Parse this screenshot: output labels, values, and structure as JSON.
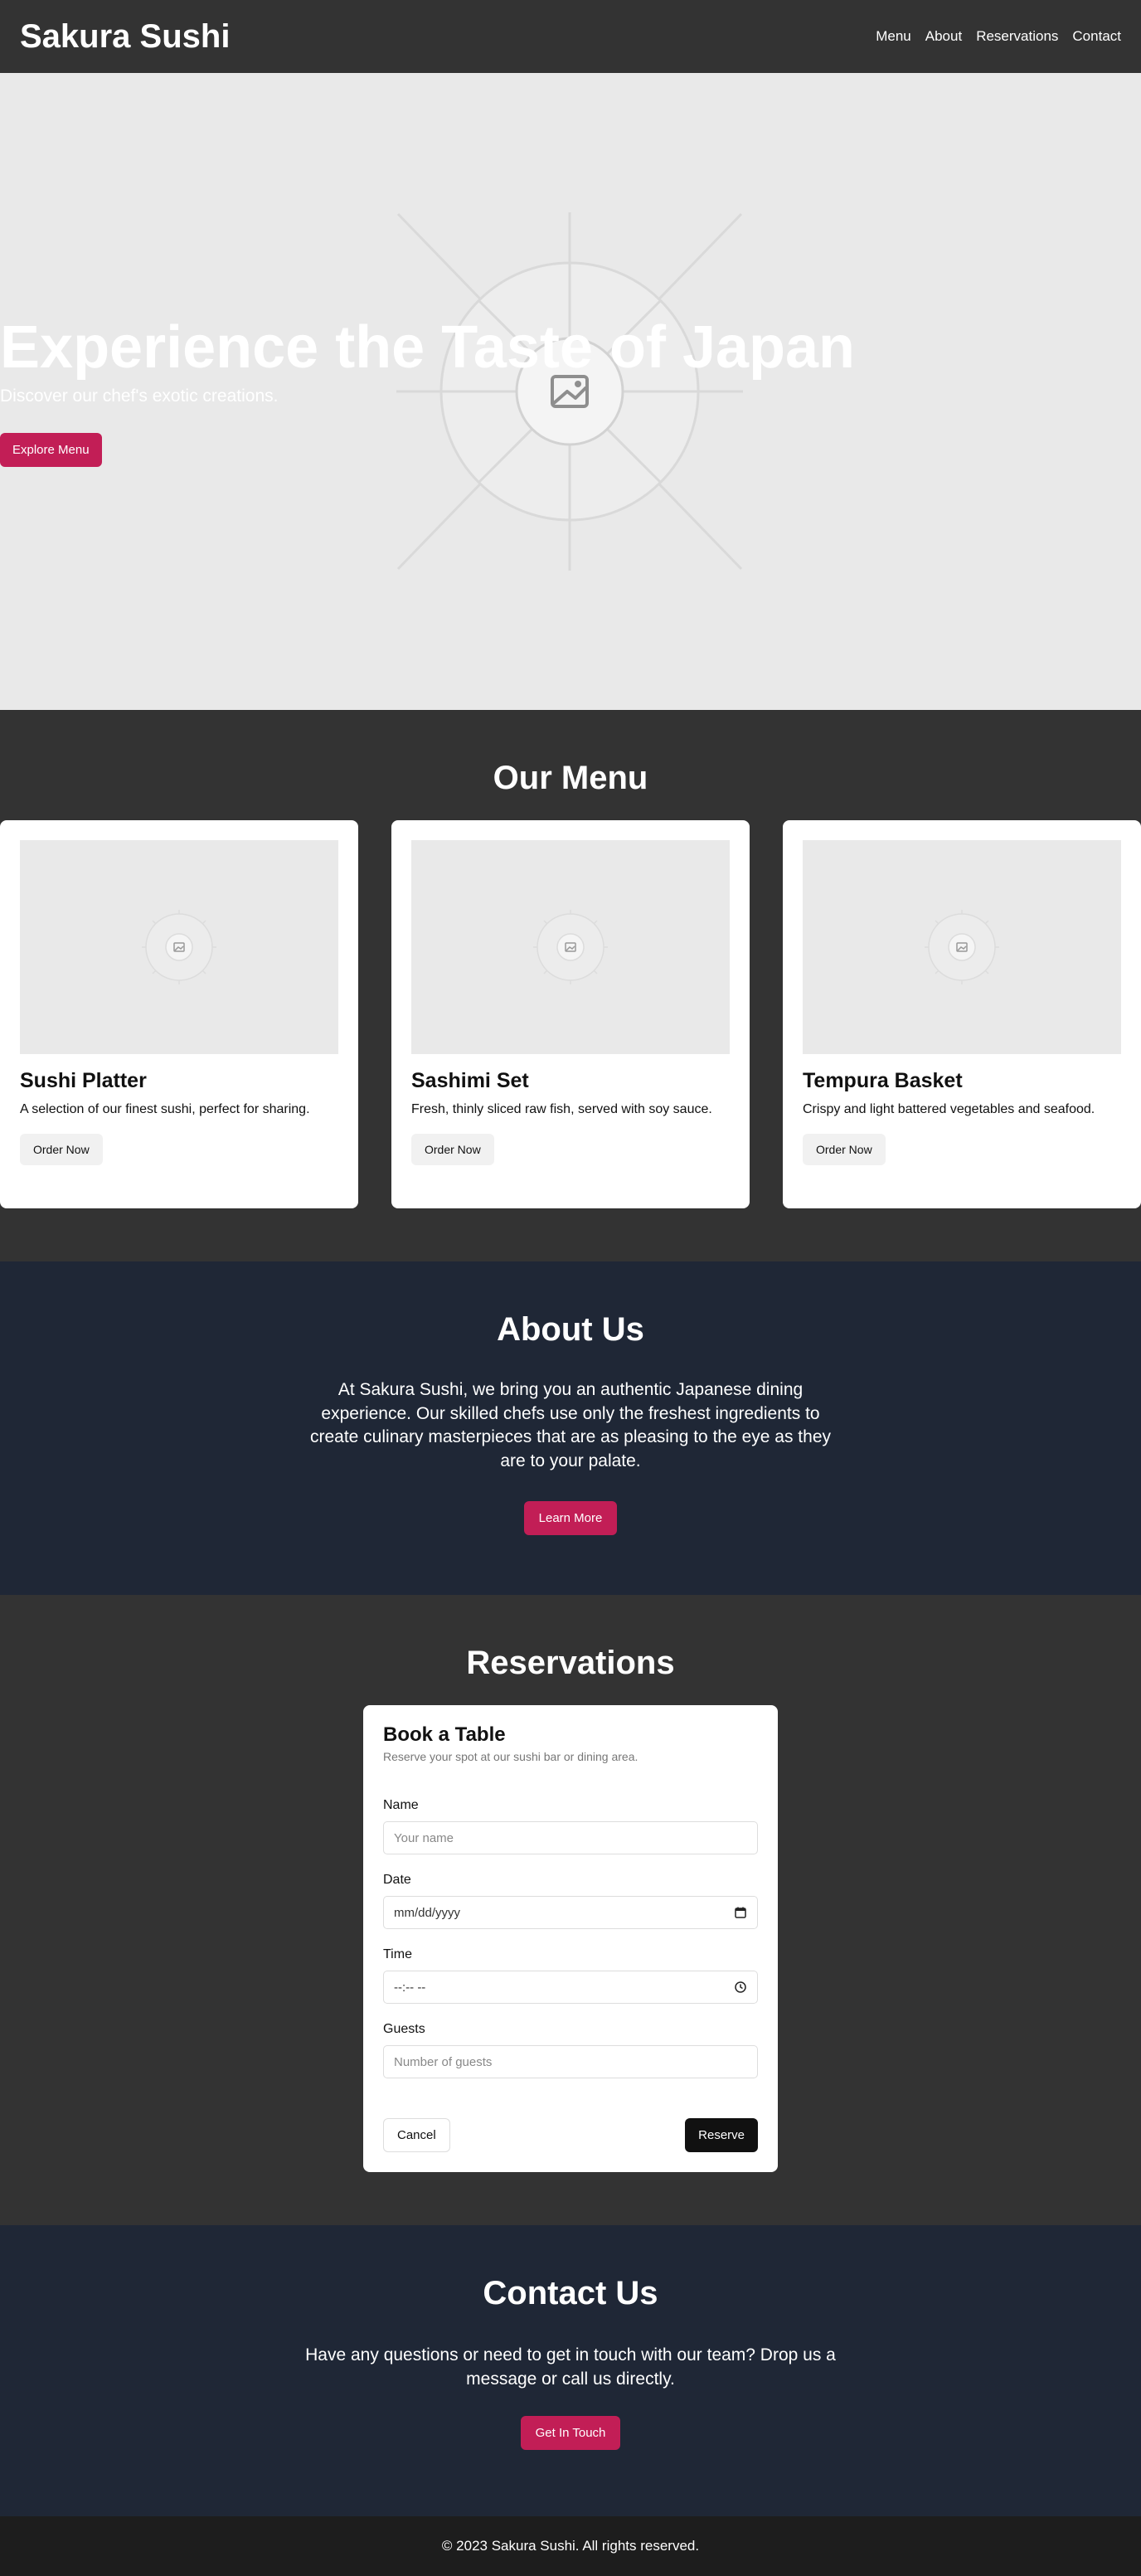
{
  "header": {
    "logo": "Sakura Sushi",
    "nav": [
      "Menu",
      "About",
      "Reservations",
      "Contact"
    ]
  },
  "hero": {
    "title": "Experience the Taste of Japan",
    "subtitle": "Discover our chef's exotic creations.",
    "button": "Explore Menu",
    "image_icon": "image-placeholder-icon"
  },
  "menu": {
    "title": "Our Menu",
    "items": [
      {
        "title": "Sushi Platter",
        "description": "A selection of our finest sushi, perfect for sharing.",
        "button": "Order Now"
      },
      {
        "title": "Sashimi Set",
        "description": "Fresh, thinly sliced raw fish, served with soy sauce.",
        "button": "Order Now"
      },
      {
        "title": "Tempura Basket",
        "description": "Crispy and light battered vegetables and seafood.",
        "button": "Order Now"
      }
    ]
  },
  "about": {
    "title": "About Us",
    "text": "At Sakura Sushi, we bring you an authentic Japanese dining experience. Our skilled chefs use only the freshest ingredients to create culinary masterpieces that are as pleasing to the eye as they are to your palate.",
    "button": "Learn More"
  },
  "reservations": {
    "title": "Reservations",
    "card_title": "Book a Table",
    "card_subtitle": "Reserve your spot at our sushi bar or dining area.",
    "fields": {
      "name": {
        "label": "Name",
        "placeholder": "Your name"
      },
      "date": {
        "label": "Date",
        "placeholder": "mm/dd/yyyy"
      },
      "time": {
        "label": "Time",
        "placeholder": "--:-- --"
      },
      "guests": {
        "label": "Guests",
        "placeholder": "Number of guests"
      }
    },
    "cancel": "Cancel",
    "submit": "Reserve"
  },
  "contact": {
    "title": "Contact Us",
    "text": "Have any questions or need to get in touch with our team? Drop us a message or call us directly.",
    "button": "Get In Touch"
  },
  "footer": {
    "text": "© 2023 Sakura Sushi. All rights reserved."
  },
  "colors": {
    "accent": "#c21e56",
    "dark": "#333333",
    "navy": "#1f2736",
    "footer": "#1d1d1d"
  }
}
